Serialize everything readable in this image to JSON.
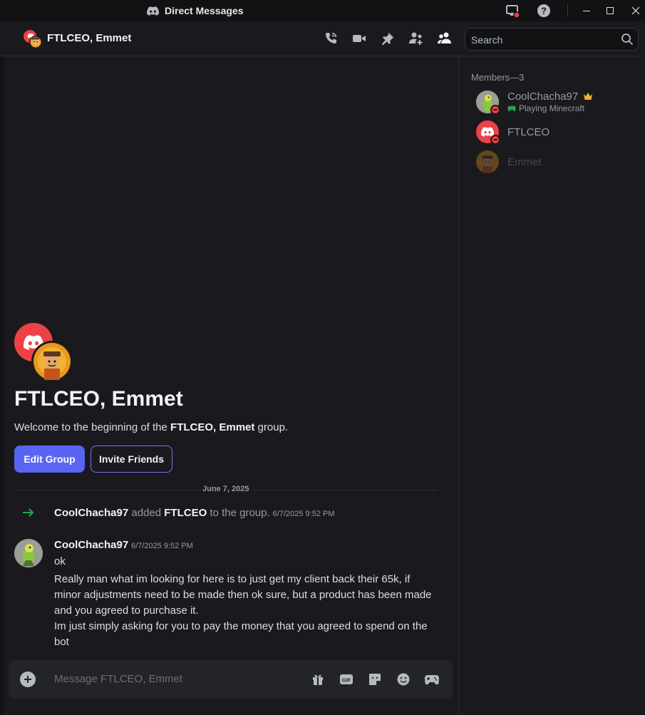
{
  "window": {
    "title": "Direct Messages",
    "controls": [
      "minimize-icon",
      "maximize-icon",
      "close-icon"
    ]
  },
  "header": {
    "group_name": "FTLCEO, Emmet",
    "actions": [
      "phone-call-icon",
      "video-call-icon",
      "pin-icon",
      "add-friends-icon",
      "members-icon"
    ],
    "search_placeholder": "Search"
  },
  "intro": {
    "title": "FTLCEO, Emmet",
    "welcome_prefix": "Welcome to the beginning of the ",
    "welcome_group": "FTLCEO, Emmet",
    "welcome_suffix": " group.",
    "edit_group_label": "Edit Group",
    "invite_friends_label": "Invite Friends"
  },
  "date_divider": "June 7, 2025",
  "system_message": {
    "actor": "CoolChacha97",
    "verb": " added ",
    "target": "FTLCEO",
    "rest": " to the group.",
    "timestamp": "6/7/2025 9:52 PM"
  },
  "message": {
    "author": "CoolChacha97",
    "timestamp": "6/7/2025 9:52 PM",
    "lines": [
      "ok",
      "Really man what im looking for here is to just get my client back their 65k, if minor adjustments need to be made then ok sure, but a product has been made and you agreed to purchase it.",
      "Im just simply asking for you to pay the money that you agreed to spend on the bot"
    ]
  },
  "composer": {
    "placeholder": "Message FTLCEO, Emmet",
    "icons": [
      "gift-icon",
      "gif-icon",
      "sticker-icon",
      "emoji-icon",
      "activity-icon"
    ]
  },
  "members": {
    "header": "Members—3",
    "list": [
      {
        "name": "CoolChacha97",
        "activity": "Playing Minecraft",
        "owner": true,
        "status": "dnd"
      },
      {
        "name": "FTLCEO",
        "activity": "",
        "owner": false,
        "status": "dnd"
      },
      {
        "name": "Emmet",
        "activity": "",
        "owner": false,
        "status": "offline"
      }
    ]
  },
  "colors": {
    "accent": "#5865f2",
    "dnd": "#f23f43",
    "discord_red": "#ed4245",
    "online_green": "#23a559",
    "owner_crown": "#f0b232"
  }
}
